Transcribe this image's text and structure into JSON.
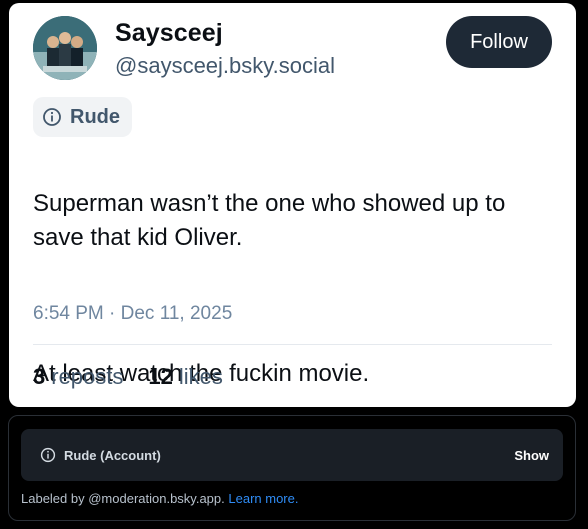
{
  "author": {
    "display_name": "Saysceej",
    "handle": "@saysceej.bsky.social"
  },
  "follow_label": "Follow",
  "content_label": "Rude",
  "post": {
    "line1": "Superman wasn’t the one who showed up to save that kid Oliver.",
    "line2": "At least watch the fuckin movie.",
    "timestamp": "6:54 PM · Dec 11, 2025"
  },
  "stats": {
    "reposts_count": "3",
    "reposts_label": "reposts",
    "likes_count": "12",
    "likes_label": "likes"
  },
  "moderation": {
    "label": "Rude (Account)",
    "show_label": "Show",
    "labeled_by": "Labeled by @moderation.bsky.app.",
    "learn_more": "Learn more."
  },
  "colors": {
    "follow_bg": "#1e2936",
    "link": "#2f8cf5",
    "secondary_text": "#42576c"
  }
}
